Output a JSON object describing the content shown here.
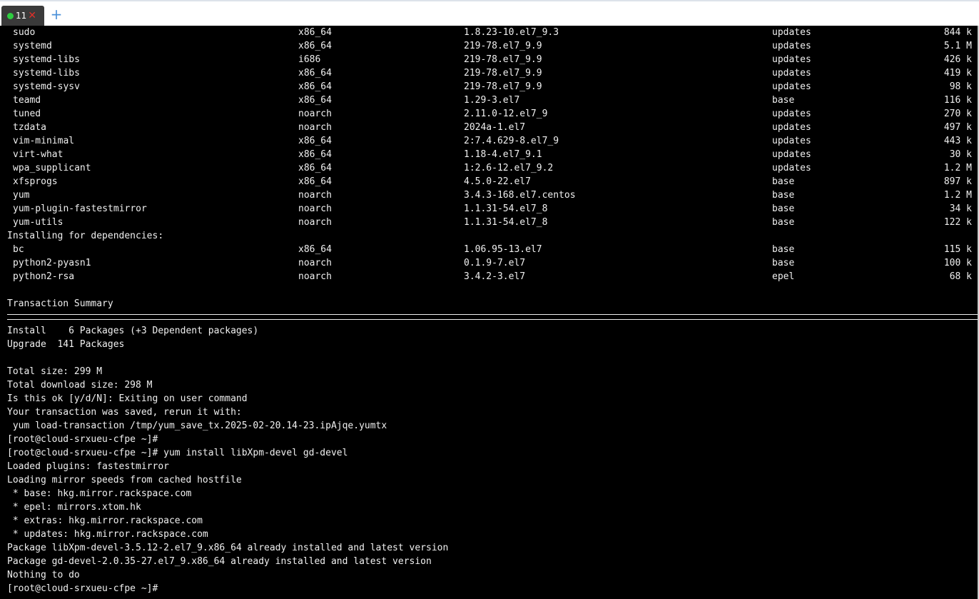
{
  "tab": {
    "count": "11",
    "close_glyph": "✕",
    "new_glyph": "+"
  },
  "packages": [
    {
      "name": "sudo",
      "arch": "x86_64",
      "version": "1.8.23-10.el7_9.3",
      "repo": "updates",
      "size": "844 k"
    },
    {
      "name": "systemd",
      "arch": "x86_64",
      "version": "219-78.el7_9.9",
      "repo": "updates",
      "size": "5.1 M"
    },
    {
      "name": "systemd-libs",
      "arch": "i686",
      "version": "219-78.el7_9.9",
      "repo": "updates",
      "size": "426 k"
    },
    {
      "name": "systemd-libs",
      "arch": "x86_64",
      "version": "219-78.el7_9.9",
      "repo": "updates",
      "size": "419 k"
    },
    {
      "name": "systemd-sysv",
      "arch": "x86_64",
      "version": "219-78.el7_9.9",
      "repo": "updates",
      "size": "98 k"
    },
    {
      "name": "teamd",
      "arch": "x86_64",
      "version": "1.29-3.el7",
      "repo": "base",
      "size": "116 k"
    },
    {
      "name": "tuned",
      "arch": "noarch",
      "version": "2.11.0-12.el7_9",
      "repo": "updates",
      "size": "270 k"
    },
    {
      "name": "tzdata",
      "arch": "noarch",
      "version": "2024a-1.el7",
      "repo": "updates",
      "size": "497 k"
    },
    {
      "name": "vim-minimal",
      "arch": "x86_64",
      "version": "2:7.4.629-8.el7_9",
      "repo": "updates",
      "size": "443 k"
    },
    {
      "name": "virt-what",
      "arch": "x86_64",
      "version": "1.18-4.el7_9.1",
      "repo": "updates",
      "size": "30 k"
    },
    {
      "name": "wpa_supplicant",
      "arch": "x86_64",
      "version": "1:2.6-12.el7_9.2",
      "repo": "updates",
      "size": "1.2 M"
    },
    {
      "name": "xfsprogs",
      "arch": "x86_64",
      "version": "4.5.0-22.el7",
      "repo": "base",
      "size": "897 k"
    },
    {
      "name": "yum",
      "arch": "noarch",
      "version": "3.4.3-168.el7.centos",
      "repo": "base",
      "size": "1.2 M"
    },
    {
      "name": "yum-plugin-fastestmirror",
      "arch": "noarch",
      "version": "1.1.31-54.el7_8",
      "repo": "base",
      "size": "34 k"
    },
    {
      "name": "yum-utils",
      "arch": "noarch",
      "version": "1.1.31-54.el7_8",
      "repo": "base",
      "size": "122 k"
    }
  ],
  "deps_header": "Installing for dependencies:",
  "dependencies": [
    {
      "name": "bc",
      "arch": "x86_64",
      "version": "1.06.95-13.el7",
      "repo": "base",
      "size": "115 k"
    },
    {
      "name": "python2-pyasn1",
      "arch": "noarch",
      "version": "0.1.9-7.el7",
      "repo": "base",
      "size": "100 k"
    },
    {
      "name": "python2-rsa",
      "arch": "noarch",
      "version": "3.4.2-3.el7",
      "repo": "epel",
      "size": "68 k"
    }
  ],
  "summary_header": "Transaction Summary",
  "output_lines": [
    "Install    6 Packages (+3 Dependent packages)",
    "Upgrade  141 Packages",
    "",
    "Total size: 299 M",
    "Total download size: 298 M",
    "Is this ok [y/d/N]: Exiting on user command",
    "Your transaction was saved, rerun it with:",
    " yum load-transaction /tmp/yum_save_tx.2025-02-20.14-23.ipAjqe.yumtx",
    "[root@cloud-srxueu-cfpe ~]#",
    "[root@cloud-srxueu-cfpe ~]# yum install libXpm-devel gd-devel",
    "Loaded plugins: fastestmirror",
    "Loading mirror speeds from cached hostfile",
    " * base: hkg.mirror.rackspace.com",
    " * epel: mirrors.xtom.hk",
    " * extras: hkg.mirror.rackspace.com",
    " * updates: hkg.mirror.rackspace.com",
    "Package libXpm-devel-3.5.12-2.el7_9.x86_64 already installed and latest version",
    "Package gd-devel-2.0.35-27.el7_9.x86_64 already installed and latest version",
    "Nothing to do",
    "[root@cloud-srxueu-cfpe ~]#"
  ],
  "colors": {
    "terminal_bg": "#000000",
    "terminal_fg": "#f0f0f0",
    "status_ok": "#2ecc40",
    "close": "#e0302a",
    "accent": "#4a90d9"
  }
}
